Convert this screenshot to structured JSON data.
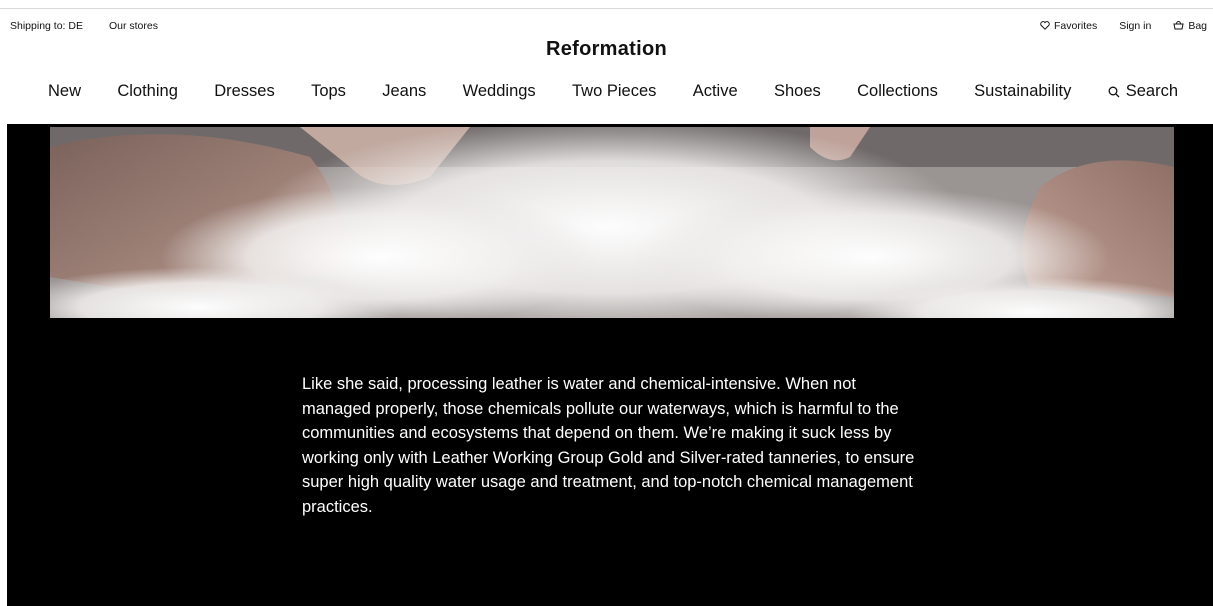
{
  "utility": {
    "shipping": "Shipping to: DE",
    "stores": "Our stores",
    "favorites": "Favorites",
    "sign_in": "Sign in",
    "bag": "Bag"
  },
  "brand": "Reformation",
  "nav": {
    "items": [
      "New",
      "Clothing",
      "Dresses",
      "Tops",
      "Jeans",
      "Weddings",
      "Two Pieces",
      "Active",
      "Shoes",
      "Collections",
      "Sustainability"
    ],
    "search": "Search"
  },
  "hero": {
    "body": "Like she said, processing leather is water and chemical-intensive. When not managed properly, those chemicals pollute our waterways, which is harmful to the communities and ecosystems that depend on them. We’re making it suck less by working only with Leather Working Group Gold and Silver-rated tanneries, to ensure super high quality water usage and treatment, and top-notch chemical management practices."
  },
  "icons": {
    "favorites": "heart-icon",
    "bag": "bag-icon",
    "search": "search-icon"
  },
  "colors": {
    "background": "#ffffff",
    "text": "#111111",
    "hero_background": "#000000",
    "hero_text": "#ffffff"
  }
}
